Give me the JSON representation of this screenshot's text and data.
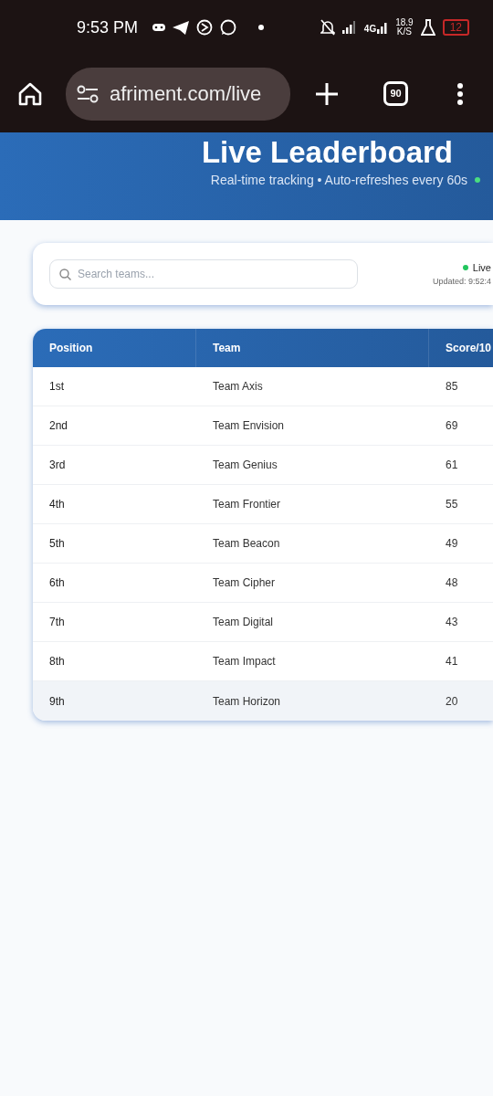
{
  "status_bar": {
    "time": "9:53 PM",
    "network": "4G",
    "speed": [
      "18.9",
      "K/S"
    ],
    "battery": "12"
  },
  "browser": {
    "url": "afriment.com/live",
    "tab_count": "90"
  },
  "header": {
    "title": "Live Leaderboard",
    "subtitle": "Real-time tracking • Auto-refreshes every 60s"
  },
  "search": {
    "placeholder": "Search teams..."
  },
  "live": {
    "label": "Live",
    "updated": "Updated: 9:52:4"
  },
  "table": {
    "columns": [
      "Position",
      "Team",
      "Score/10"
    ],
    "rows": [
      {
        "position": "1st",
        "team": "Team Axis",
        "score": "85",
        "selected": false
      },
      {
        "position": "2nd",
        "team": "Team Envision",
        "score": "69",
        "selected": false
      },
      {
        "position": "3rd",
        "team": "Team Genius",
        "score": "61",
        "selected": false
      },
      {
        "position": "4th",
        "team": "Team Frontier",
        "score": "55",
        "selected": false
      },
      {
        "position": "5th",
        "team": "Team Beacon",
        "score": "49",
        "selected": false
      },
      {
        "position": "6th",
        "team": "Team Cipher",
        "score": "48",
        "selected": false
      },
      {
        "position": "7th",
        "team": "Team Digital",
        "score": "43",
        "selected": false
      },
      {
        "position": "8th",
        "team": "Team Impact",
        "score": "41",
        "selected": false
      },
      {
        "position": "9th",
        "team": "Team Horizon",
        "score": "20",
        "selected": true
      }
    ]
  }
}
